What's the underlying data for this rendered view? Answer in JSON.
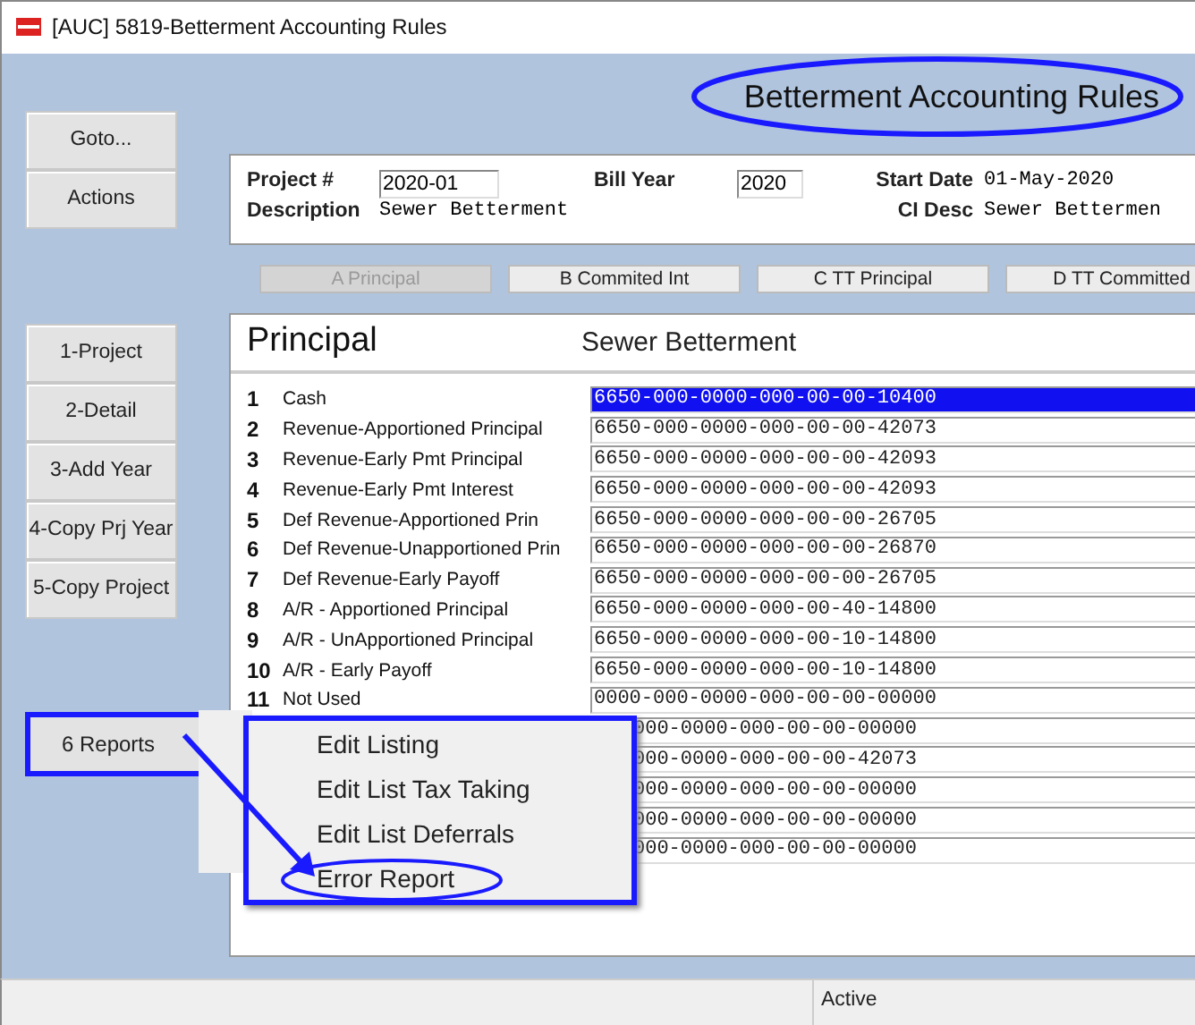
{
  "window": {
    "title": "[AUC] 5819-Betterment Accounting Rules"
  },
  "screen_title": {
    "text": "Betterment Accounting Rules",
    "circled": true
  },
  "side_buttons_top": [
    "Goto...",
    "Actions"
  ],
  "side_buttons": [
    "1-Project",
    "2-Detail",
    "3-Add Year",
    "4-Copy Prj Year",
    "5-Copy Project"
  ],
  "reports_button": {
    "label": "6 Reports",
    "highlighted": true
  },
  "header": {
    "project_label": "Project #",
    "project": "2020-01",
    "bill_year_label": "Bill Year",
    "bill_year": "2020",
    "start_date_label": "Start Date",
    "start_date": "01-May-2020",
    "description_label": "Description",
    "description": "Sewer Betterment",
    "ci_desc_label": "CI Desc",
    "ci_desc": "Sewer Bettermen"
  },
  "tabs": [
    {
      "label": "A Principal",
      "disabled": true
    },
    {
      "label": "B Commited Int",
      "disabled": false
    },
    {
      "label": "C TT Principal",
      "disabled": false
    },
    {
      "label": "D TT Committed",
      "disabled": false
    }
  ],
  "panel": {
    "title": "Principal",
    "subtitle": "Sewer Betterment"
  },
  "rows": [
    {
      "number": "1",
      "label": "Cash",
      "account": "6650-000-0000-000-00-00-10400",
      "selected": true
    },
    {
      "number": "2",
      "label": "Revenue-Apportioned Principal",
      "account": "6650-000-0000-000-00-00-42073",
      "selected": false
    },
    {
      "number": "3",
      "label": "Revenue-Early Pmt Principal",
      "account": "6650-000-0000-000-00-00-42093",
      "selected": false
    },
    {
      "number": "4",
      "label": "Revenue-Early Pmt Interest",
      "account": "6650-000-0000-000-00-00-42093",
      "selected": false
    },
    {
      "number": "5",
      "label": "Def Revenue-Apportioned Prin",
      "account": "6650-000-0000-000-00-00-26705",
      "selected": false
    },
    {
      "number": "6",
      "label": "Def Revenue-Unapportioned Prin",
      "account": "6650-000-0000-000-00-00-26870",
      "selected": false
    },
    {
      "number": "7",
      "label": "Def Revenue-Early Payoff",
      "account": "6650-000-0000-000-00-00-26705",
      "selected": false
    },
    {
      "number": "8",
      "label": "A/R - Apportioned Principal",
      "account": "6650-000-0000-000-00-40-14800",
      "selected": false
    },
    {
      "number": "9",
      "label": "A/R - UnApportioned Principal",
      "account": "6650-000-0000-000-00-10-14800",
      "selected": false
    },
    {
      "number": "10",
      "label": "A/R - Early Payoff",
      "account": "6650-000-0000-000-00-10-14800",
      "selected": false
    },
    {
      "number": "11",
      "label": "Not Used",
      "account": "0000-000-0000-000-00-00-00000",
      "selected": false
    },
    {
      "account": "000-0000-000-00-00-00000",
      "selected": false
    },
    {
      "account": "000-0000-000-00-00-42073",
      "selected": false
    },
    {
      "account": "000-0000-000-00-00-00000",
      "selected": false
    },
    {
      "account": "000-0000-000-00-00-00000",
      "selected": false
    },
    {
      "account": "000-0000-000-00-00-00000",
      "selected": false
    }
  ],
  "reports_menu": [
    {
      "label": "Edit Listing",
      "circled": false
    },
    {
      "label": "Edit List Tax Taking",
      "circled": false
    },
    {
      "label": "Edit List Deferrals",
      "circled": false
    },
    {
      "label": "Error Report",
      "circled": true
    }
  ],
  "status_bar": {
    "status": "Active"
  }
}
